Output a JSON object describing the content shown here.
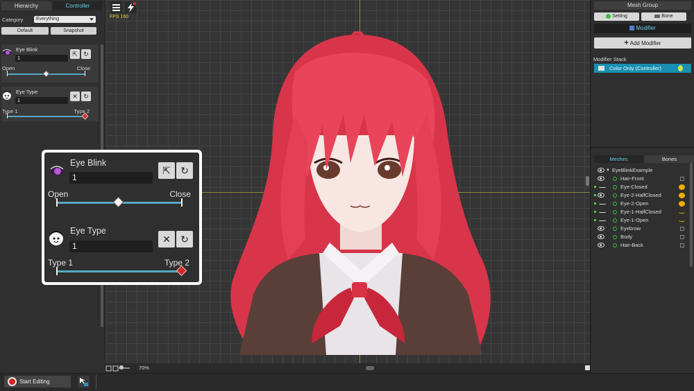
{
  "left_panel": {
    "tabs": [
      "Hierarchy",
      "Controller"
    ],
    "category_label": "Category",
    "category_value": "Everything",
    "default_button": "Default",
    "snapshot_button": "Snapshot",
    "controls": [
      {
        "name": "Eye Blink",
        "value": "1",
        "min_label": "Open",
        "max_label": "Close",
        "position": 0.5
      },
      {
        "name": "Eye Type",
        "value": "1",
        "min_label": "Type 1",
        "max_label": "Type 2",
        "position": 1.0
      }
    ]
  },
  "canvas": {
    "fps": "FPS 160",
    "zoom": "70%"
  },
  "bottom": {
    "start_editing": "Start Editing"
  },
  "right_panel": {
    "mesh_group": "Mesh Group",
    "setting_button": "Setting",
    "bone_button": "Bone",
    "modifier_tab": "Modifier",
    "add_modifier": "Add Modifier",
    "modifier_stack_label": "Modifier Stack",
    "modifier_item": "Color Only (Controller)",
    "tabs": [
      "Meshes",
      "Bones"
    ],
    "root": "EyeBlinkExample",
    "meshes": [
      "Hair-Front",
      "Eye-Closed",
      "Eye-2-HalfClosed",
      "Eye-2-Open",
      "Eye-1-HalfClosed",
      "Eye-1-Open",
      "Eyebrow",
      "Body",
      "Hair-Back"
    ]
  },
  "colors": {
    "accent": "#5fd3e8",
    "selection": "#1a8fb0",
    "slider": "#55a8c2",
    "record": "#d0241c",
    "hair": "#e0404f"
  }
}
